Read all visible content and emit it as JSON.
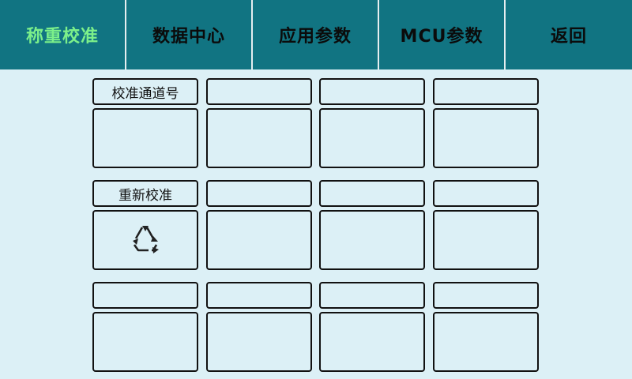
{
  "nav": {
    "tabs": [
      {
        "label": "称重校准",
        "active": true
      },
      {
        "label": "数据中心"
      },
      {
        "label": "应用参数"
      },
      {
        "label": "MCU参数"
      },
      {
        "label": "返回"
      }
    ]
  },
  "panel": {
    "calib_channel_label": "校准通道号",
    "recalibrate_label": "重新校准",
    "recalibrate_icon": "recycle-icon"
  },
  "colors": {
    "header_bg": "#117482",
    "active_tab": "#7cf08a",
    "page_bg": "#dcf0f6"
  }
}
